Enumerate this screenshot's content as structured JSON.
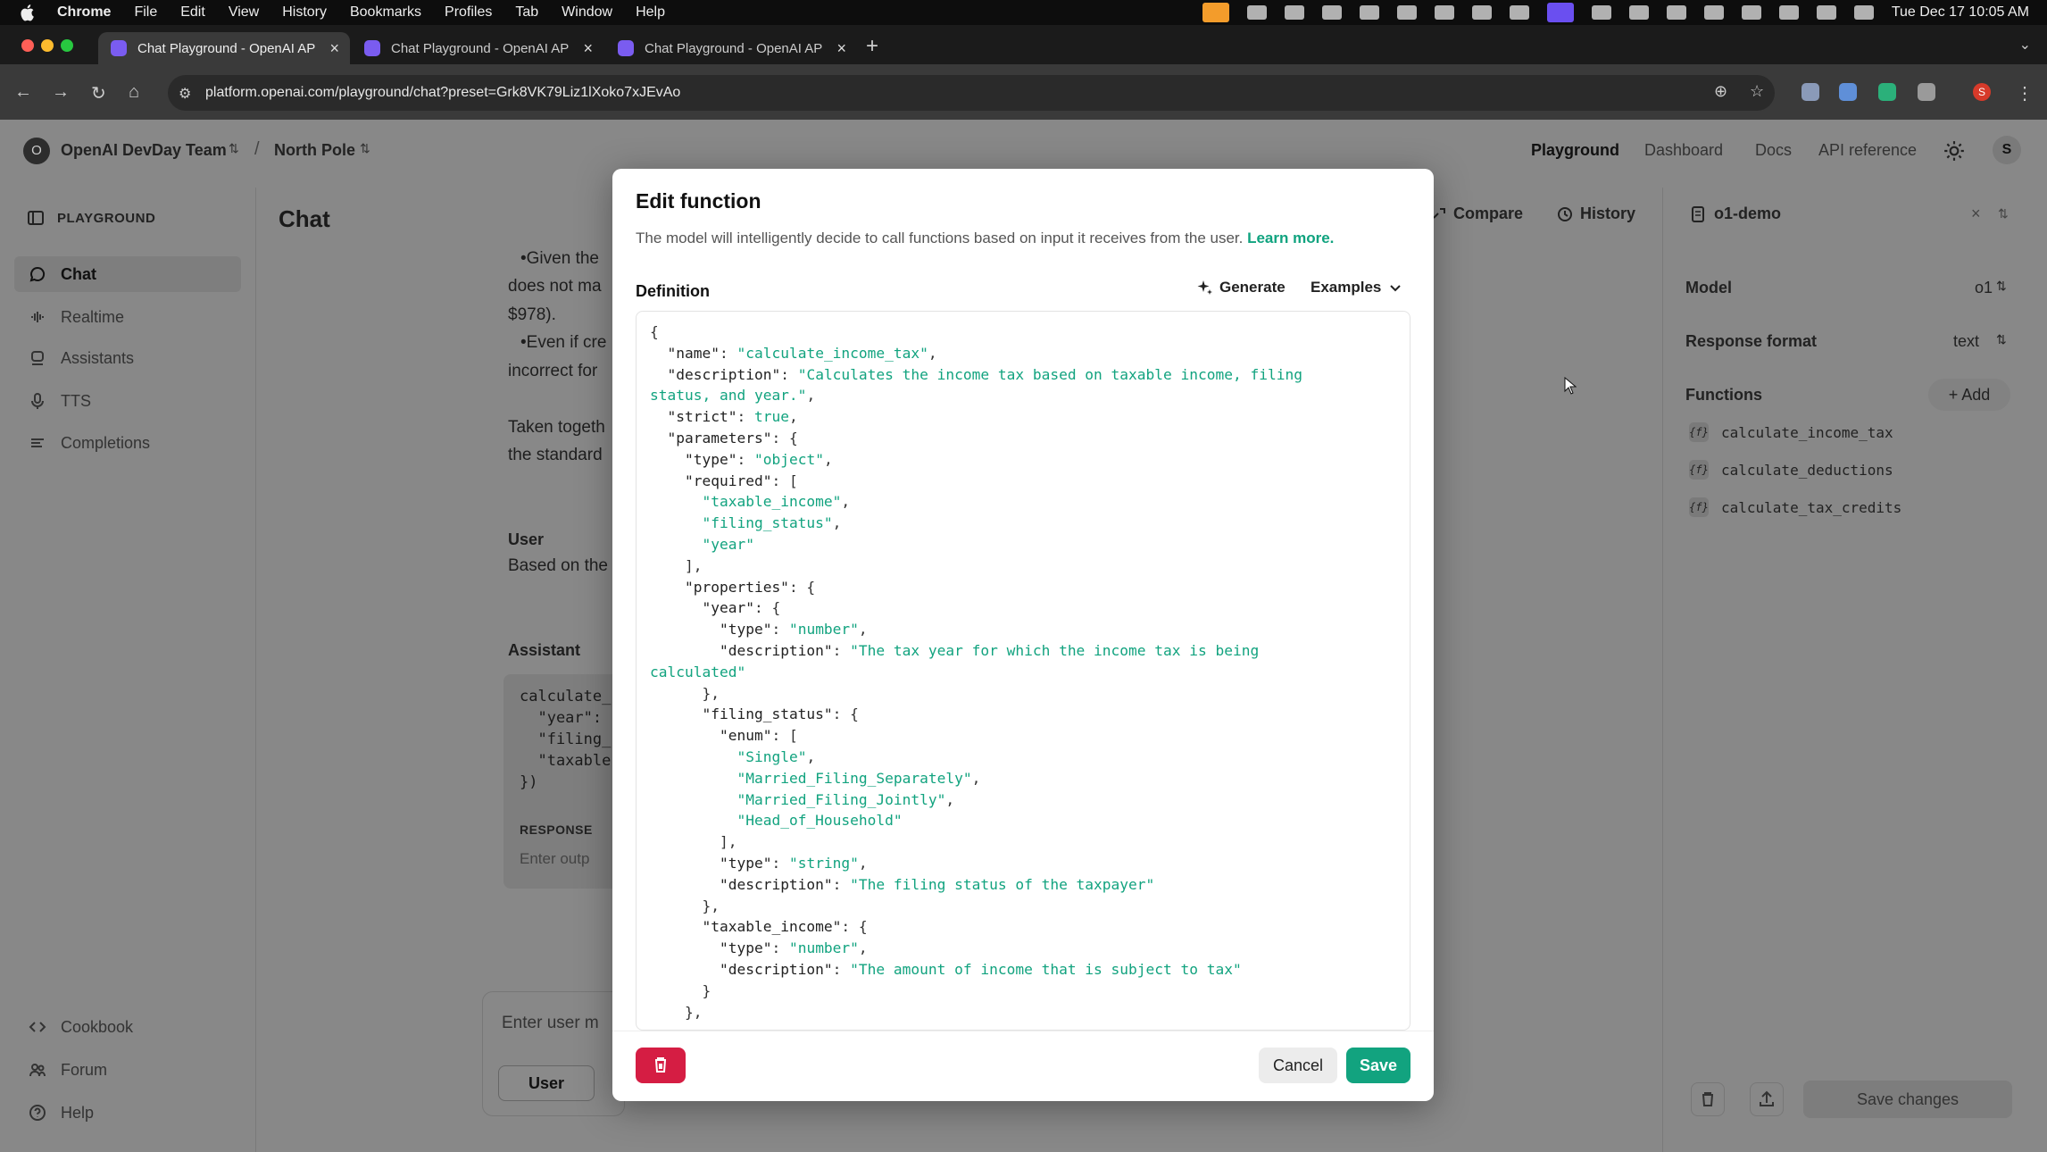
{
  "menubar": {
    "app": "Chrome",
    "items": [
      "File",
      "Edit",
      "View",
      "History",
      "Bookmarks",
      "Profiles",
      "Tab",
      "Window",
      "Help"
    ],
    "clock": "Tue Dec 17  10:05 AM"
  },
  "browser": {
    "tabs": [
      {
        "label": "Chat Playground - OpenAI API"
      },
      {
        "label": "Chat Playground - OpenAI API"
      },
      {
        "label": "Chat Playground - OpenAI API"
      }
    ],
    "url": "platform.openai.com/playground/chat?preset=Grk8VK79Liz1lXoko7xJEvAo",
    "profile_initial": "S"
  },
  "topnav": {
    "org_initial": "O",
    "org": "OpenAI DevDay Team",
    "project": "North Pole",
    "links": [
      "Playground",
      "Dashboard",
      "Docs",
      "API reference"
    ],
    "user_initial": "S"
  },
  "sidebar": {
    "heading": "PLAYGROUND",
    "items": [
      {
        "label": "Chat",
        "icon": "chat-bubble-icon"
      },
      {
        "label": "Realtime",
        "icon": "waveform-icon"
      },
      {
        "label": "Assistants",
        "icon": "assistant-icon"
      },
      {
        "label": "TTS",
        "icon": "microphone-icon"
      },
      {
        "label": "Completions",
        "icon": "lines-icon"
      }
    ],
    "footer": [
      {
        "label": "Cookbook",
        "icon": "code-icon"
      },
      {
        "label": "Forum",
        "icon": "people-icon"
      },
      {
        "label": "Help",
        "icon": "help-icon"
      }
    ]
  },
  "chat": {
    "title": "Chat",
    "text_lines": [
      "•Given the",
      "does not ma",
      "$978).",
      "•Even if cre",
      "incorrect for",
      "Taken togeth",
      "the standard"
    ],
    "user_label": "User",
    "user_text": "Based on the",
    "assistant_label": "Assistant",
    "assistant_code": [
      "calculate_",
      "  \"year\":",
      "  \"filing_",
      "  \"taxable",
      "})"
    ],
    "response_label": "RESPONSE",
    "response_placeholder": "Enter outp",
    "input_placeholder": "Enter user m",
    "role_button": "User"
  },
  "right_panel": {
    "compare": "Compare",
    "history": "History",
    "preset_name": "o1-demo",
    "model_label": "Model",
    "model_value": "o1",
    "format_label": "Response format",
    "format_value": "text",
    "functions_label": "Functions",
    "add_label": "+ Add",
    "functions": [
      "calculate_income_tax",
      "calculate_deductions",
      "calculate_tax_credits"
    ],
    "fn_badge": "{f}",
    "save_changes": "Save changes"
  },
  "modal": {
    "title": "Edit function",
    "description": "The model will intelligently decide to call functions based on input it receives from the user.",
    "learn_more": "Learn more.",
    "definition_label": "Definition",
    "generate_label": "Generate",
    "examples_label": "Examples",
    "code_lines": [
      "{",
      "  \"name\": \"calculate_income_tax\",",
      "  \"description\": \"Calculates the income tax based on taxable income, filing",
      "status, and year.\",",
      "  \"strict\": true,",
      "  \"parameters\": {",
      "    \"type\": \"object\",",
      "    \"required\": [",
      "      \"taxable_income\",",
      "      \"filing_status\",",
      "      \"year\"",
      "    ],",
      "    \"properties\": {",
      "      \"year\": {",
      "        \"type\": \"number\",",
      "        \"description\": \"The tax year for which the income tax is being",
      "calculated\"",
      "      },",
      "      \"filing_status\": {",
      "        \"enum\": [",
      "          \"Single\",",
      "          \"Married_Filing_Separately\",",
      "          \"Married_Filing_Jointly\",",
      "          \"Head_of_Household\"",
      "        ],",
      "        \"type\": \"string\",",
      "        \"description\": \"The filing status of the taxpayer\"",
      "      },",
      "      \"taxable_income\": {",
      "        \"type\": \"number\",",
      "        \"description\": \"The amount of income that is subject to tax\"",
      "      }",
      "    },"
    ],
    "cancel_label": "Cancel",
    "save_label": "Save"
  },
  "colors": {
    "accent": "#10a37f",
    "danger": "#d51d43"
  }
}
